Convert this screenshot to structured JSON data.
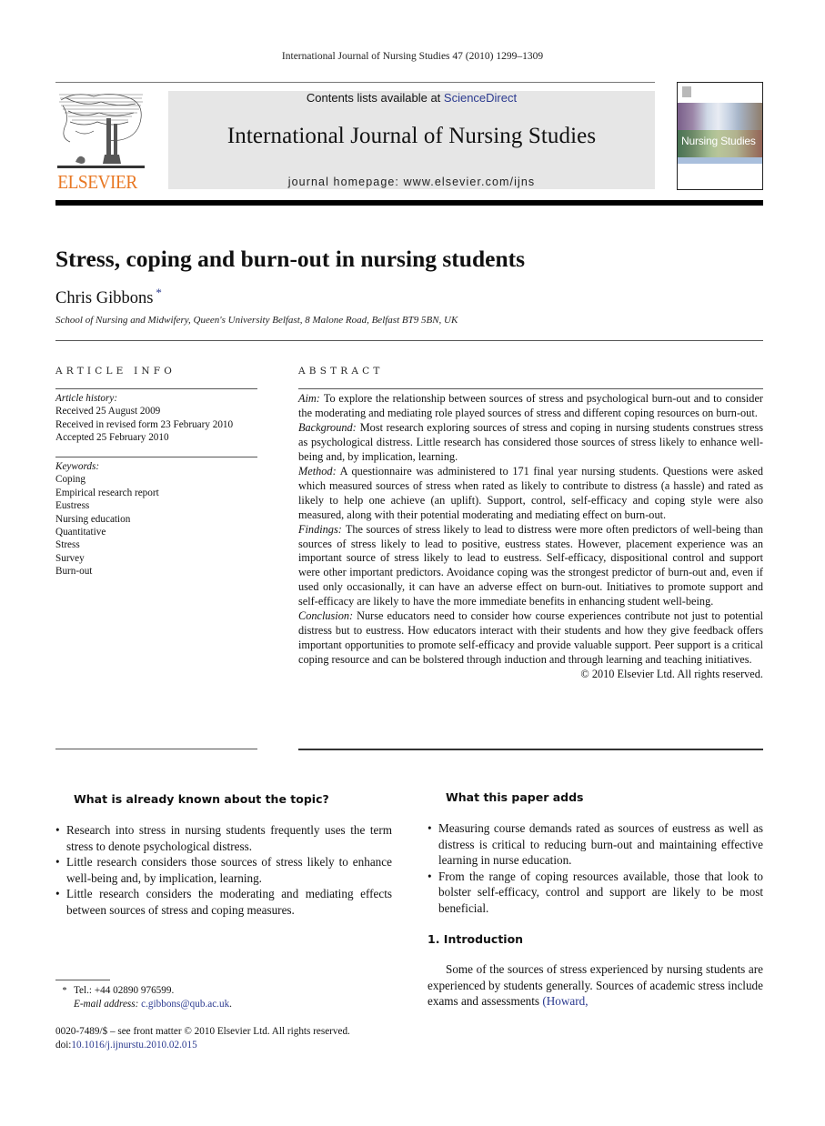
{
  "running_header": "International Journal of Nursing Studies 47 (2010) 1299–1309",
  "masthead": {
    "publisher": "ELSEVIER",
    "contents_prefix": "Contents lists available at ",
    "contents_link": "ScienceDirect",
    "journal_title": "International Journal of Nursing Studies",
    "homepage": "journal homepage: www.elsevier.com/ijns",
    "cover_title": "Nursing Studies"
  },
  "article": {
    "title": "Stress, coping and burn-out in nursing students",
    "author": "Chris Gibbons",
    "author_mark": "*",
    "affiliation": "School of Nursing and Midwifery, Queen's University Belfast, 8 Malone Road, Belfast BT9 5BN, UK"
  },
  "article_info": {
    "label": "ARTICLE INFO",
    "history_label": "Article history:",
    "history": [
      "Received 25 August 2009",
      "Received in revised form 23 February 2010",
      "Accepted 25 February 2010"
    ],
    "keywords_label": "Keywords:",
    "keywords": [
      "Coping",
      "Empirical research report",
      "Eustress",
      "Nursing education",
      "Quantitative",
      "Stress",
      "Survey",
      "Burn-out"
    ]
  },
  "abstract": {
    "label": "ABSTRACT",
    "sections": [
      {
        "label": "Aim:",
        "text": "To explore the relationship between sources of stress and psychological burn-out and to consider the moderating and mediating role played sources of stress and different coping resources on burn-out."
      },
      {
        "label": "Background:",
        "text": "Most research exploring sources of stress and coping in nursing students construes stress as psychological distress. Little research has considered those sources of stress likely to enhance well-being and, by implication, learning."
      },
      {
        "label": "Method:",
        "text": "A questionnaire was administered to 171 final year nursing students. Questions were asked which measured sources of stress when rated as likely to contribute to distress (a hassle) and rated as likely to help one achieve (an uplift). Support, control, self-efficacy and coping style were also measured, along with their potential moderating and mediating effect on burn-out."
      },
      {
        "label": "Findings:",
        "text": "The sources of stress likely to lead to distress were more often predictors of well-being than sources of stress likely to lead to positive, eustress states. However, placement experience was an important source of stress likely to lead to eustress. Self-efficacy, dispositional control and support were other important predictors. Avoidance coping was the strongest predictor of burn-out and, even if used only occasionally, it can have an adverse effect on burn-out. Initiatives to promote support and self-efficacy are likely to have the more immediate benefits in enhancing student well-being."
      },
      {
        "label": "Conclusion:",
        "text": "Nurse educators need to consider how course experiences contribute not just to potential distress but to eustress. How educators interact with their students and how they give feedback offers important opportunities to promote self-efficacy and provide valuable support. Peer support is a critical coping resource and can be bolstered through induction and through learning and teaching initiatives."
      }
    ],
    "copyright": "© 2010 Elsevier Ltd. All rights reserved."
  },
  "known": {
    "heading": "What is already known about the topic?",
    "items": [
      "Research into stress in nursing students frequently uses the term stress to denote psychological distress.",
      "Little research considers those sources of stress likely to enhance well-being and, by implication, learning.",
      "Little research considers the moderating and mediating effects between sources of stress and coping measures."
    ]
  },
  "adds": {
    "heading": "What this paper adds",
    "items": [
      "Measuring course demands rated as sources of eustress as well as distress is critical to reducing burn-out and maintaining effective learning in nurse education.",
      "From the range of coping resources available, those that look to bolster self-efficacy, control and support are likely to be most beneficial."
    ]
  },
  "introduction": {
    "heading": "1. Introduction",
    "text": "Some of the sources of stress experienced by nursing students are experienced by students generally. Sources of academic stress include exams and assessments ",
    "citation": "(Howard,"
  },
  "footnotes": {
    "mark": "*",
    "tel": "Tel.: +44 02890 976599.",
    "email_label": "E-mail address:",
    "email": "c.gibbons@qub.ac.uk",
    "front_matter": "0020-7489/$ – see front matter © 2010 Elsevier Ltd. All rights reserved.",
    "doi_prefix": "doi:",
    "doi": "10.1016/j.ijnurstu.2010.02.015"
  },
  "bullet_glyph": "•"
}
